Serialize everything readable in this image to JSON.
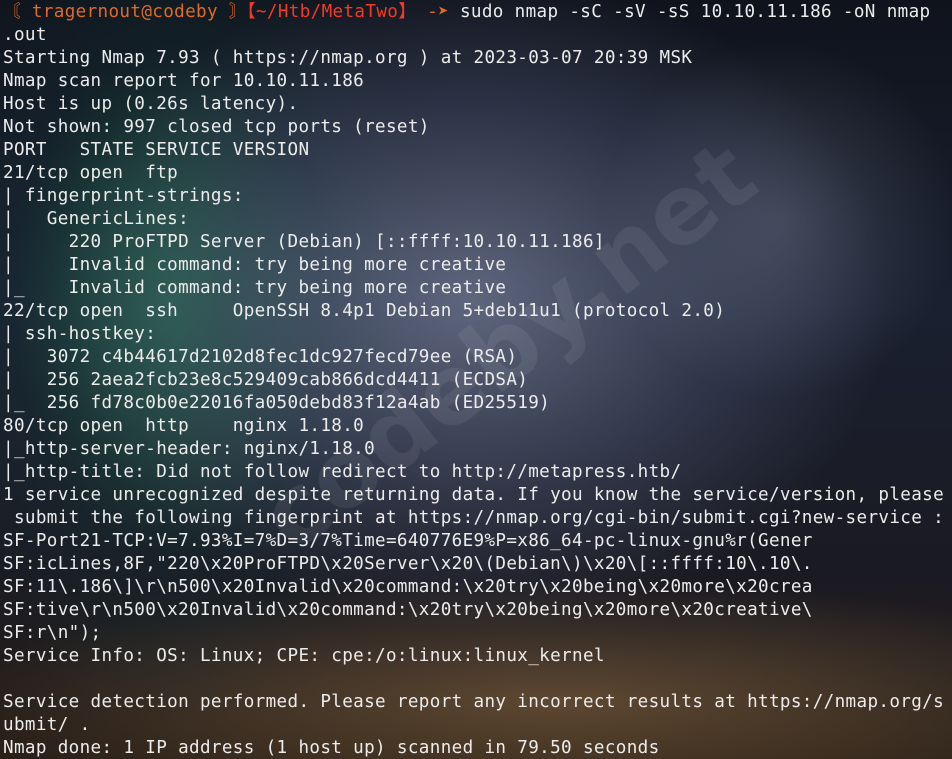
{
  "prompt": {
    "bracket_open": "〘 ",
    "user_host": "tragernout@codeby",
    "bracket_close": " 〙",
    "path": "【~/Htb/MetaTwo】",
    "arrow": " -➤ ",
    "command": "sudo nmap -sC -sV -sS 10.10.11.186 -oN nmap",
    "command_wrap": ".out"
  },
  "watermark": "codeby.net",
  "output": [
    "Starting Nmap 7.93 ( https://nmap.org ) at 2023-03-07 20:39 MSK",
    "Nmap scan report for 10.10.11.186",
    "Host is up (0.26s latency).",
    "Not shown: 997 closed tcp ports (reset)",
    "PORT   STATE SERVICE VERSION",
    "21/tcp open  ftp",
    "| fingerprint-strings:",
    "|   GenericLines:",
    "|     220 ProFTPD Server (Debian) [::ffff:10.10.11.186]",
    "|     Invalid command: try being more creative",
    "|_    Invalid command: try being more creative",
    "22/tcp open  ssh     OpenSSH 8.4p1 Debian 5+deb11u1 (protocol 2.0)",
    "| ssh-hostkey:",
    "|   3072 c4b44617d2102d8fec1dc927fecd79ee (RSA)",
    "|   256 2aea2fcb23e8c529409cab866dcd4411 (ECDSA)",
    "|_  256 fd78c0b0e22016fa050debd83f12a4ab (ED25519)",
    "80/tcp open  http    nginx 1.18.0",
    "|_http-server-header: nginx/1.18.0",
    "|_http-title: Did not follow redirect to http://metapress.htb/",
    "1 service unrecognized despite returning data. If you know the service/version, please",
    " submit the following fingerprint at https://nmap.org/cgi-bin/submit.cgi?new-service :",
    "SF-Port21-TCP:V=7.93%I=7%D=3/7%Time=640776E9%P=x86_64-pc-linux-gnu%r(Gener",
    "SF:icLines,8F,\"220\\x20ProFTPD\\x20Server\\x20\\(Debian\\)\\x20\\[::ffff:10\\.10\\.",
    "SF:11\\.186\\]\\r\\n500\\x20Invalid\\x20command:\\x20try\\x20being\\x20more\\x20crea",
    "SF:tive\\r\\n500\\x20Invalid\\x20command:\\x20try\\x20being\\x20more\\x20creative\\",
    "SF:r\\n\");",
    "Service Info: OS: Linux; CPE: cpe:/o:linux:linux_kernel",
    "",
    "Service detection performed. Please report any incorrect results at https://nmap.org/s",
    "ubmit/ .",
    "Nmap done: 1 IP address (1 host up) scanned in 79.50 seconds"
  ]
}
